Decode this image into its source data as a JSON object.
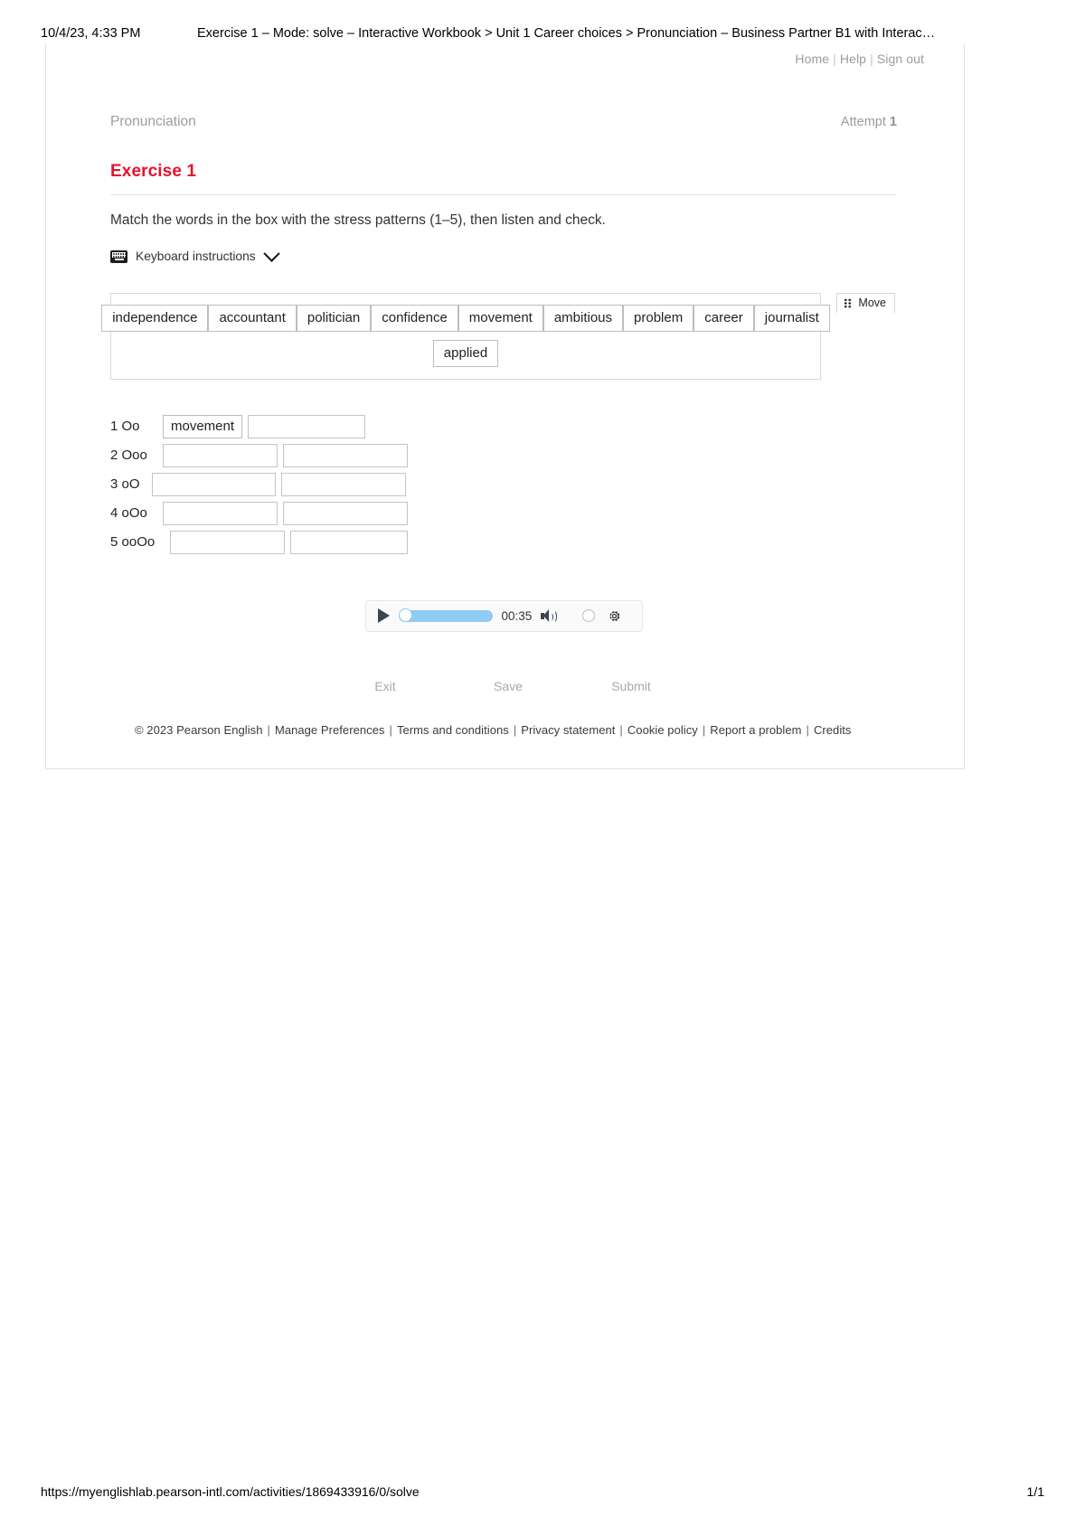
{
  "print_header": {
    "date": "10/4/23, 4:33 PM",
    "title": "Exercise 1 – Mode: solve – Interactive Workbook > Unit 1 Career choices > Pronunciation – Business Partner B1 with Interac…"
  },
  "topnav": {
    "home": "Home",
    "help": "Help",
    "signout": "Sign out",
    "separator": "|"
  },
  "activity": {
    "section_name": "Pronunciation",
    "attempt_label": "Attempt",
    "attempt_value": "1",
    "exercise_title": "Exercise 1",
    "instruction": "Match the words in the box with the stress patterns (1–5), then listen and check.",
    "keyboard_instructions": "Keyboard instructions",
    "accent_color": "#e8112d"
  },
  "word_bank": {
    "move_label": "Move",
    "row1": [
      "independence",
      "accountant",
      "politician",
      "confidence",
      "movement",
      "ambitious",
      "problem",
      "career",
      "journalist"
    ],
    "row2": [
      "applied"
    ]
  },
  "patterns": [
    {
      "label": "1 Oo",
      "slot1": "movement",
      "slot2": "",
      "w1": 88,
      "w2": 130
    },
    {
      "label": "2 Ooo",
      "slot1": "",
      "slot2": "",
      "w1": 127,
      "w2": 138
    },
    {
      "label": "3 oO",
      "slot1": "",
      "slot2": "",
      "w1": 137,
      "w2": 138
    },
    {
      "label": "4 oOo",
      "slot1": "",
      "slot2": "",
      "w1": 127,
      "w2": 138
    },
    {
      "label": "5 ooOo",
      "slot1": "",
      "slot2": "",
      "w1": 127,
      "w2": 130
    }
  ],
  "audio_player": {
    "time": "00:35",
    "progress_percent": 0,
    "track_color": "#8ecbf5"
  },
  "actions": {
    "exit": "Exit",
    "save": "Save",
    "submit": "Submit"
  },
  "footer": {
    "copyright": "© 2023 Pearson English",
    "links": [
      "Manage Preferences",
      "Terms and conditions",
      "Privacy statement",
      "Cookie policy",
      "Report a problem",
      "Credits"
    ],
    "separator": "|"
  },
  "print_footer": {
    "url": "https://myenglishlab.pearson-intl.com/activities/1869433916/0/solve",
    "page": "1/1"
  }
}
